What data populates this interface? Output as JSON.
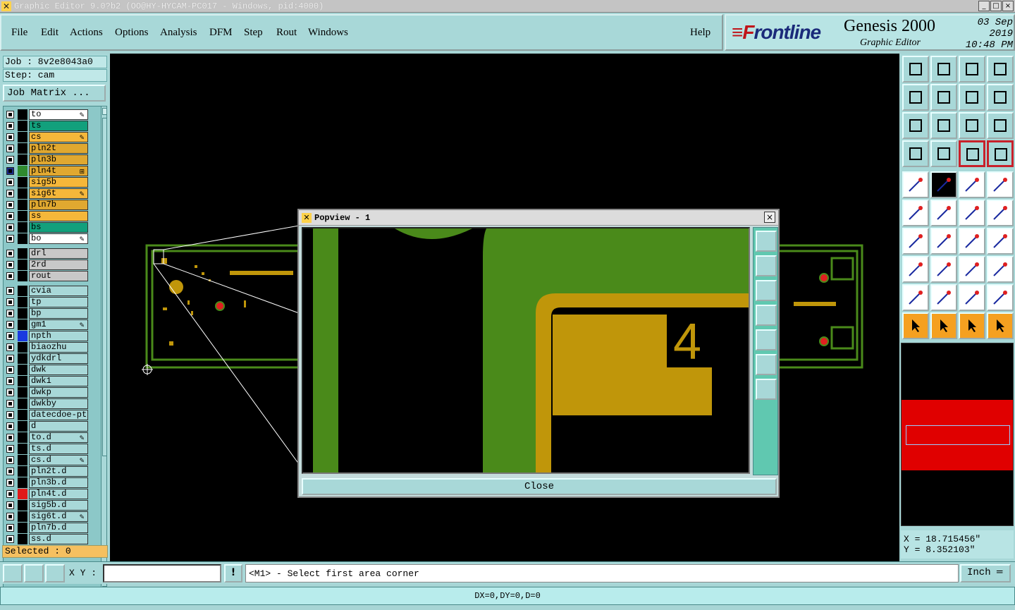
{
  "window": {
    "title": "Graphic Editor 9.0?b2 (OO@HY-HYCAM-PC017 - Windows, pid:4000)",
    "min_glyph": "_",
    "max_glyph": "□",
    "close_glyph": "×"
  },
  "menu": {
    "items": [
      "File",
      "Edit",
      "Actions",
      "Options",
      "Analysis",
      "DFM",
      "Step",
      "Rout",
      "Windows"
    ],
    "help": "Help"
  },
  "brand": {
    "logo_f": "≡F",
    "logo_rest": "rontline",
    "product": "Genesis 2000",
    "subtitle": "Graphic Editor",
    "date": "03 Sep 2019",
    "time": "10:48 PM"
  },
  "job": {
    "job_label": "Job : 8v2e8043a0",
    "step_label": "Step: cam",
    "matrix_button": "Job Matrix ..."
  },
  "layers": [
    {
      "name": "to",
      "color": "#ffffff",
      "swatch": "#000",
      "mark": "✎"
    },
    {
      "name": "ts",
      "color": "#12a07c",
      "swatch": "#000",
      "mark": ""
    },
    {
      "name": "cs",
      "color": "#f5b73a",
      "swatch": "#000",
      "mark": "✎"
    },
    {
      "name": "pln2t",
      "color": "#e0a830",
      "swatch": "#000",
      "mark": ""
    },
    {
      "name": "pln3b",
      "color": "#e0a830",
      "swatch": "#000",
      "mark": ""
    },
    {
      "name": "pln4t",
      "color": "#e0a830",
      "swatch": "#2f8a2f",
      "mark": "⊞",
      "cbfill": "#1a2a8a"
    },
    {
      "name": "sig5b",
      "color": "#f5b73a",
      "swatch": "#000",
      "mark": ""
    },
    {
      "name": "sig6t",
      "color": "#f5b73a",
      "swatch": "#000",
      "mark": "✎"
    },
    {
      "name": "pln7b",
      "color": "#e0a830",
      "swatch": "#000",
      "mark": ""
    },
    {
      "name": "ss",
      "color": "#f5b73a",
      "swatch": "#000",
      "mark": ""
    },
    {
      "name": "bs",
      "color": "#12a07c",
      "swatch": "#000",
      "mark": ""
    },
    {
      "name": "bo",
      "color": "#ffffff",
      "swatch": "#000",
      "mark": "✎"
    },
    {
      "name": "drl",
      "color": "#c8c8c8",
      "swatch": "#000",
      "mark": ""
    },
    {
      "name": "2rd",
      "color": "#c8c8c8",
      "swatch": "#000",
      "mark": ""
    },
    {
      "name": "rout",
      "color": "#c8c8c8",
      "swatch": "#000",
      "mark": ""
    },
    {
      "name": "cvia",
      "color": "#a8d8d8",
      "swatch": "#000",
      "mark": ""
    },
    {
      "name": "tp",
      "color": "#a8d8d8",
      "swatch": "#000",
      "mark": ""
    },
    {
      "name": "bp",
      "color": "#a8d8d8",
      "swatch": "#000",
      "mark": ""
    },
    {
      "name": "gm1",
      "color": "#a8d8d8",
      "swatch": "#000",
      "mark": "✎"
    },
    {
      "name": "npth",
      "color": "#a8d8d8",
      "swatch": "#1a3ae0",
      "mark": ""
    },
    {
      "name": "biaozhu",
      "color": "#a8d8d8",
      "swatch": "#000",
      "mark": ""
    },
    {
      "name": "ydkdrl",
      "color": "#a8d8d8",
      "swatch": "#000",
      "mark": ""
    },
    {
      "name": "dwk",
      "color": "#a8d8d8",
      "swatch": "#000",
      "mark": ""
    },
    {
      "name": "dwk1",
      "color": "#a8d8d8",
      "swatch": "#000",
      "mark": ""
    },
    {
      "name": "dwkp",
      "color": "#a8d8d8",
      "swatch": "#000",
      "mark": ""
    },
    {
      "name": "dwkby",
      "color": "#a8d8d8",
      "swatch": "#000",
      "mark": ""
    },
    {
      "name": "datecdoe-pte",
      "color": "#a8d8d8",
      "swatch": "#000",
      "mark": ""
    },
    {
      "name": "d",
      "color": "#a8d8d8",
      "swatch": "#000",
      "mark": ""
    },
    {
      "name": "to.d",
      "color": "#a8d8d8",
      "swatch": "#000",
      "mark": "✎"
    },
    {
      "name": "ts.d",
      "color": "#a8d8d8",
      "swatch": "#000",
      "mark": ""
    },
    {
      "name": "cs.d",
      "color": "#a8d8d8",
      "swatch": "#000",
      "mark": "✎"
    },
    {
      "name": "pln2t.d",
      "color": "#a8d8d8",
      "swatch": "#000",
      "mark": ""
    },
    {
      "name": "pln3b.d",
      "color": "#a8d8d8",
      "swatch": "#000",
      "mark": ""
    },
    {
      "name": "pln4t.d",
      "color": "#a8d8d8",
      "swatch": "#e01a1a",
      "mark": ""
    },
    {
      "name": "sig5b.d",
      "color": "#a8d8d8",
      "swatch": "#000",
      "mark": ""
    },
    {
      "name": "sig6t.d",
      "color": "#a8d8d8",
      "swatch": "#000",
      "mark": "✎"
    },
    {
      "name": "pln7b.d",
      "color": "#a8d8d8",
      "swatch": "#000",
      "mark": ""
    },
    {
      "name": "ss.d",
      "color": "#a8d8d8",
      "swatch": "#000",
      "mark": ""
    }
  ],
  "selected": "Selected : 0",
  "popview": {
    "title": "Popview - 1",
    "close_x": "×",
    "label_digit": "4",
    "close_button": "Close"
  },
  "coords": {
    "x": "X = 18.715456\"",
    "y": "Y = 8.352103\""
  },
  "bottom": {
    "xy_label": "X Y :",
    "xy_value": "",
    "excl": "!",
    "prompt": "<M1> - Select first area corner",
    "unit": "Inch ═"
  },
  "status": "DX=0,DY=0,D=0",
  "toolbar_icons": [
    "top-icon",
    "bottom-icon",
    "home-icon",
    "panel-icon",
    "left-icon",
    "right-icon",
    "undo-icon",
    "zigzag-icon",
    "fit-icon",
    "center-icon",
    "ratio-icon",
    "help-icon",
    "tools-icon",
    "grid-icon",
    "snap-icon",
    "snap2-icon",
    "select-icon",
    "box-icon",
    "ruler-icon",
    "circle-icon",
    "net-icon",
    "cross-icon",
    "line-icon",
    "point-icon",
    "angle-icon",
    "slash-icon",
    "arc-icon",
    "split-icon",
    "connect-icon",
    "dash-icon",
    "measure-icon",
    "blob-icon",
    "tri-icon",
    "tri2-icon",
    "tri3-icon",
    "tri4-icon",
    "pointer-icon",
    "pointer2-icon",
    "pointer3-icon",
    "route-icon"
  ],
  "colors": {
    "board_green": "#4a8a1a",
    "copper": "#c0960a",
    "pad_red": "#e02020"
  }
}
